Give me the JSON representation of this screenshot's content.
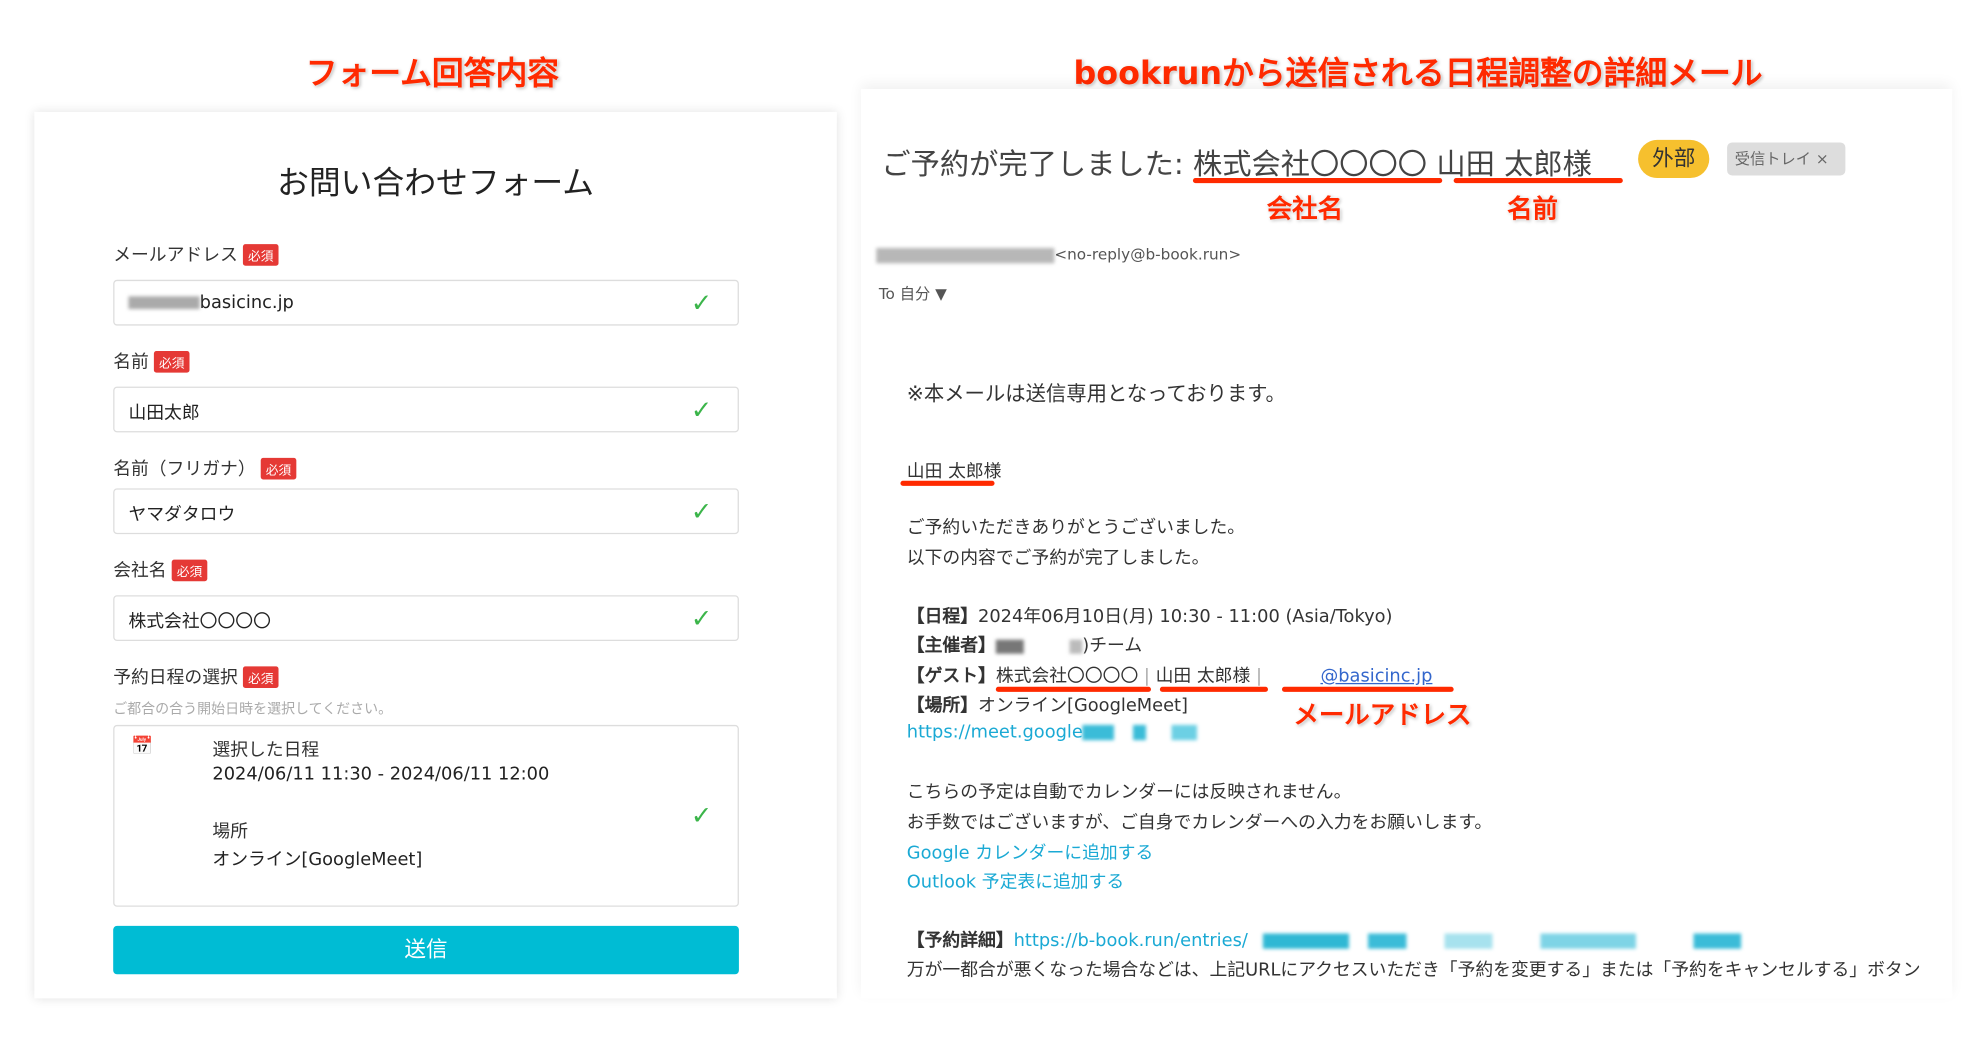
{
  "captions": {
    "left": "フォーム回答内容",
    "right": "bookrunから送信される日程調整の詳細メール"
  },
  "form": {
    "title": "お問い合わせフォーム",
    "required_badge": "必須",
    "fields": [
      {
        "label": "メールアドレス",
        "value": "basicinc.jp"
      },
      {
        "label": "名前",
        "value": "山田太郎"
      },
      {
        "label": "名前（フリガナ）",
        "value": "ヤマダタロウ"
      },
      {
        "label": "会社名",
        "value": "株式会社〇〇〇〇"
      }
    ],
    "schedule": {
      "label": "予約日程の選択",
      "hint": "ご都合の合う開始日時を選択してください。",
      "selected_title": "選択した日程",
      "selected_value": "2024/06/11 11:30 - 2024/06/11 12:00",
      "place_title": "場所",
      "place_value": "オンライン[GoogleMeet]"
    },
    "submit_label": "送信"
  },
  "email": {
    "subject_prefix": "ご予約が完了しました: ",
    "subject_company": "株式会社〇〇〇〇",
    "subject_name": "山田 太郎様",
    "tag_external": "外部",
    "tag_inbox": "受信トレイ",
    "tag_close": "×",
    "sender": "<no-reply@b-book.run>",
    "to": "To 自分",
    "notice": "※本メールは送信専用となっております。",
    "greeting": "山田 太郎様",
    "lines": [
      "ご予約いただきありがとうございました。",
      "以下の内容でご予約が完了しました。"
    ],
    "date_label": "【日程】",
    "date_value": "2024年06月10日(月) 10:30 - 11:00 (Asia/Tokyo)",
    "host_label": "【主催者】",
    "host_value": ")チーム",
    "guest_label": "【ゲスト】",
    "guest_company": "株式会社〇〇〇〇",
    "guest_name": "山田 太郎様",
    "guest_email": "@basicinc.jp",
    "separator": "|",
    "place_label": "【場所】",
    "place_value": "オンライン[GoogleMeet]",
    "meet_link": "https://meet.google",
    "calendar_lines": [
      "こちらの予定は自動でカレンダーには反映されません。",
      "お手数ではございますが、ご自身でカレンダーへの入力をお願いします。"
    ],
    "google_link": "Google カレンダーに追加する",
    "outlook_link": "Outlook 予定表に追加する",
    "detail_label": "【予約詳細】",
    "detail_link": "https://b-book.run/entries/",
    "last_line": "万が一都合が悪くなった場合などは、上記URLにアクセスいただき「予約を変更する」または「予約をキャンセルする」ボタン"
  },
  "annotations": {
    "company": "会社名",
    "name": "名前",
    "email": "メールアドレス"
  },
  "colors": {
    "accent_red": "#ff2a00",
    "submit": "#00bcd4",
    "check": "#3bb54a",
    "external_tag": "#f6c02e"
  }
}
